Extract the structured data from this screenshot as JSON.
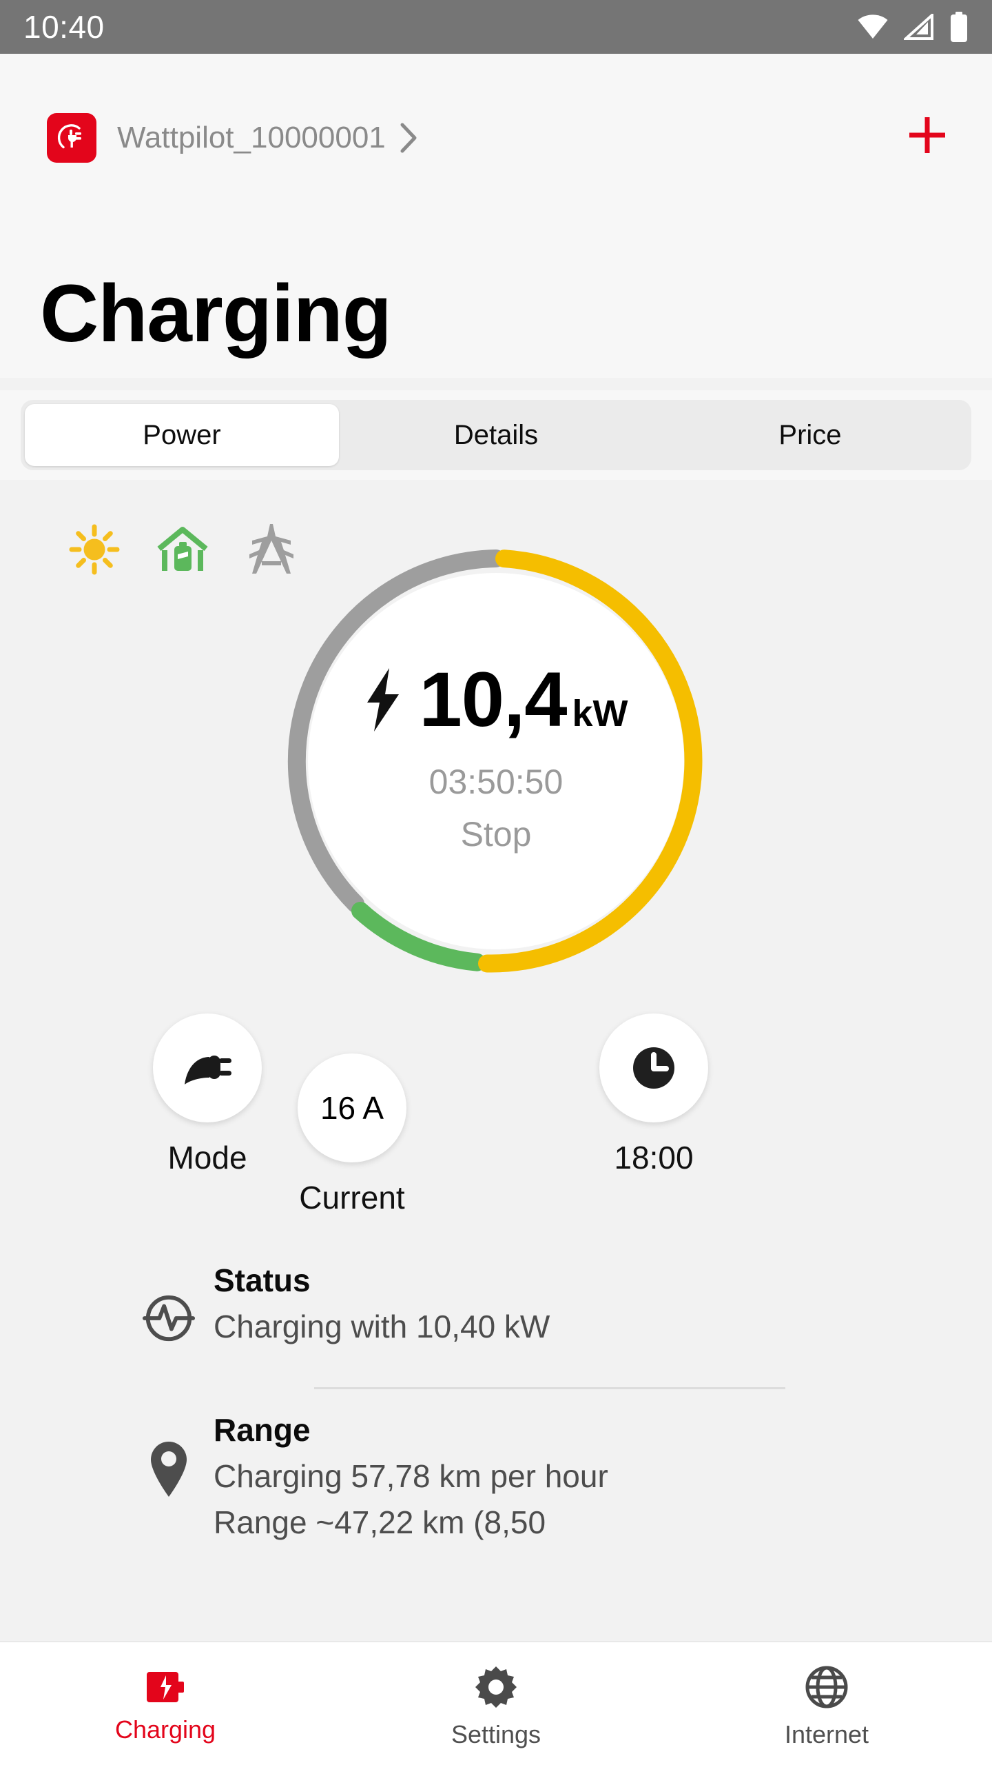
{
  "statusbar": {
    "time": "10:40",
    "icons": [
      "wifi-icon",
      "cellular-signal-icon",
      "battery-icon"
    ]
  },
  "header": {
    "logo_icon": "wattpilot-plug-logo-icon",
    "device_name": "Wattpilot_10000001",
    "chevron_icon": "chevron-right-icon",
    "add_icon": "plus-icon",
    "page_title": "Charging"
  },
  "tabs": [
    {
      "label": "Power",
      "active": true
    },
    {
      "label": "Details",
      "active": false
    },
    {
      "label": "Price",
      "active": false
    }
  ],
  "sources": [
    {
      "name": "solar-sun-icon",
      "color": "#F5BE1E"
    },
    {
      "name": "home-battery-icon",
      "color": "#5CB85C"
    },
    {
      "name": "grid-pylon-icon",
      "color": "#9E9E9E"
    }
  ],
  "gauge": {
    "bolt_icon": "lightning-bolt-icon",
    "value": "10,4",
    "unit": "kW",
    "timer": "03:50:50",
    "action_label": "Stop",
    "segments": [
      {
        "name": "grid",
        "color": "#9E9E9E",
        "share_pct": 28
      },
      {
        "name": "solar",
        "color": "#F5BE00",
        "share_pct": 58
      },
      {
        "name": "home",
        "color": "#5CB85C",
        "share_pct": 14
      }
    ]
  },
  "actions": [
    {
      "name": "mode",
      "icon": "plug-icon",
      "value": "",
      "label": "Mode"
    },
    {
      "name": "current",
      "icon": "",
      "value": "16 A",
      "label": "Current"
    },
    {
      "name": "clock",
      "icon": "clock-icon",
      "value": "",
      "label": "18:00"
    }
  ],
  "info": [
    {
      "icon": "pulse-circle-icon",
      "title": "Status",
      "lines": [
        "Charging with 10,40 kW"
      ]
    },
    {
      "icon": "location-pin-icon",
      "title": "Range",
      "lines": [
        "Charging 57,78 km per hour",
        "Range ~47,22 km (8,50"
      ]
    }
  ],
  "bottomnav": [
    {
      "label": "Charging",
      "icon": "battery-bolt-icon",
      "active": true
    },
    {
      "label": "Settings",
      "icon": "gear-icon",
      "active": false
    },
    {
      "label": "Internet",
      "icon": "globe-icon",
      "active": false
    }
  ],
  "colors": {
    "brand_red": "#E3051B",
    "solar_yellow": "#F5BE00",
    "home_green": "#5CB85C",
    "grid_gray": "#9E9E9E",
    "page_bg": "#F2F2F2",
    "header_bg": "#F7F7F7"
  }
}
